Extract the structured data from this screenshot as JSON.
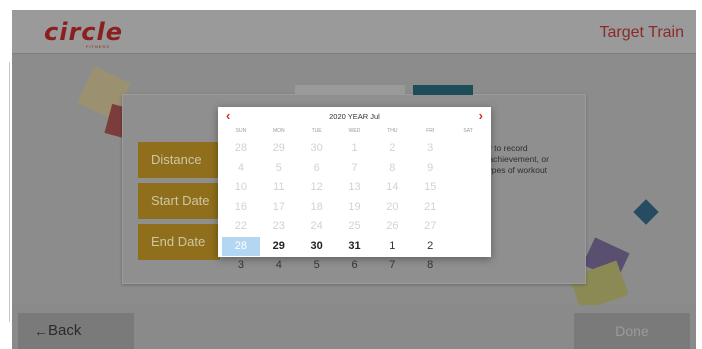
{
  "header": {
    "logo_text": "circle",
    "logo_sub": "FITNESS",
    "title": "Target Train"
  },
  "form": {
    "fields": [
      {
        "label": "Distance"
      },
      {
        "label": "Start Date"
      },
      {
        "label": "End Date"
      }
    ],
    "description": [
      "vity to record",
      "et achievement, or",
      "ll types of workout"
    ]
  },
  "footer": {
    "back_label": "Back",
    "back_icon": "←",
    "done_label": "Done"
  },
  "calendar": {
    "title": "2020 YEAR Jul",
    "prev_icon": "‹",
    "next_icon": "›",
    "weekdays": [
      "SUN",
      "MON",
      "TUE",
      "WED",
      "THU",
      "FRI",
      "SAT"
    ],
    "days": [
      {
        "label": "28",
        "state": "disabled"
      },
      {
        "label": "29",
        "state": "disabled"
      },
      {
        "label": "30",
        "state": "disabled"
      },
      {
        "label": "1",
        "state": "disabled"
      },
      {
        "label": "2",
        "state": "disabled"
      },
      {
        "label": "3",
        "state": "disabled"
      },
      {
        "label": "4",
        "state": "disabled"
      },
      {
        "label": "5",
        "state": "disabled"
      },
      {
        "label": "6",
        "state": "disabled"
      },
      {
        "label": "7",
        "state": "disabled"
      },
      {
        "label": "8",
        "state": "disabled"
      },
      {
        "label": "9",
        "state": "disabled"
      },
      {
        "label": "10",
        "state": "disabled"
      },
      {
        "label": "11",
        "state": "disabled"
      },
      {
        "label": "12",
        "state": "disabled"
      },
      {
        "label": "13",
        "state": "disabled"
      },
      {
        "label": "14",
        "state": "disabled"
      },
      {
        "label": "15",
        "state": "disabled"
      },
      {
        "label": "16",
        "state": "disabled"
      },
      {
        "label": "17",
        "state": "disabled"
      },
      {
        "label": "18",
        "state": "disabled"
      },
      {
        "label": "19",
        "state": "disabled"
      },
      {
        "label": "20",
        "state": "disabled"
      },
      {
        "label": "21",
        "state": "disabled"
      },
      {
        "label": "22",
        "state": "disabled"
      },
      {
        "label": "23",
        "state": "disabled"
      },
      {
        "label": "24",
        "state": "disabled"
      },
      {
        "label": "25",
        "state": "disabled"
      },
      {
        "label": "26",
        "state": "disabled"
      },
      {
        "label": "27",
        "state": "disabled"
      },
      {
        "label": "28",
        "state": "selected"
      },
      {
        "label": "29",
        "state": "bold"
      },
      {
        "label": "30",
        "state": "bold"
      },
      {
        "label": "31",
        "state": "bold"
      },
      {
        "label": "1",
        "state": "active"
      },
      {
        "label": "2",
        "state": "active"
      },
      {
        "label": "3",
        "state": "active"
      },
      {
        "label": "4",
        "state": "active"
      },
      {
        "label": "5",
        "state": "active"
      },
      {
        "label": "6",
        "state": "active"
      },
      {
        "label": "7",
        "state": "active"
      },
      {
        "label": "8",
        "state": "active"
      }
    ],
    "selected_color": "#b3d7f3",
    "nav_color": "#d32f2f"
  },
  "colors": {
    "field_button": "#8f6f1b",
    "brand": "#8b1e1e"
  }
}
